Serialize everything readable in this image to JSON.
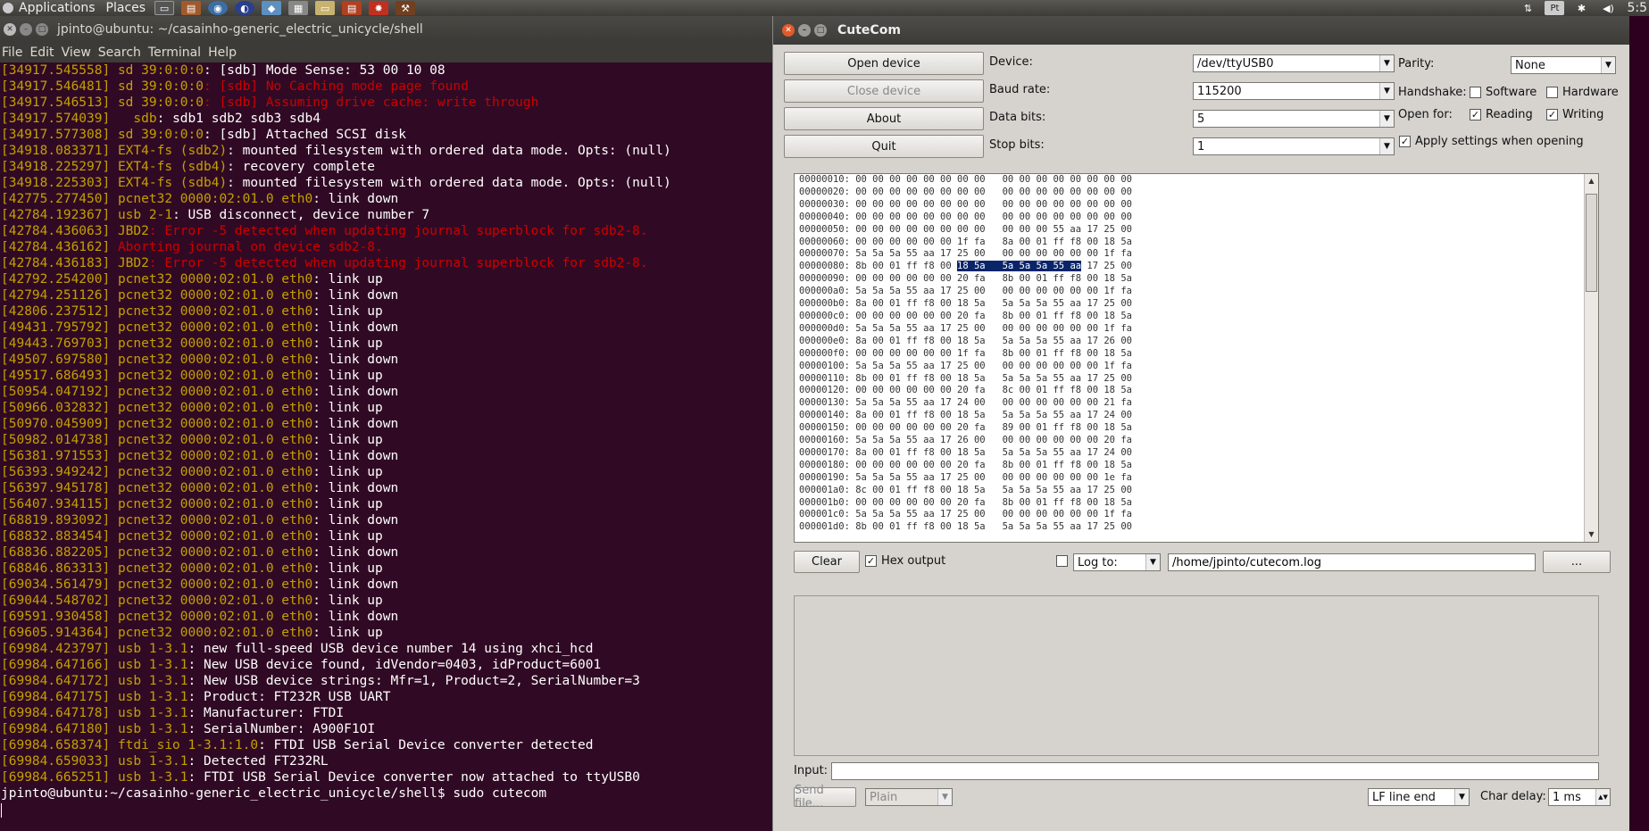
{
  "topbar": {
    "applications": "Applications",
    "places": "Places",
    "clock": "5:5"
  },
  "terminal": {
    "title": "jpinto@ubuntu: ~/casainho-generic_electric_unicycle/shell",
    "menu": [
      "File",
      "Edit",
      "View",
      "Search",
      "Terminal",
      "Help"
    ],
    "lines": [
      {
        "ts": "[34917.545558]",
        "src": "sd 39:0:0:0",
        "msg": ": [sdb] Mode Sense: 53 00 10 08",
        "err": false
      },
      {
        "ts": "[34917.546481]",
        "src": "sd 39:0:0:0",
        "msg": ": [sdb] No Caching mode page found",
        "err": true
      },
      {
        "ts": "[34917.546513]",
        "src": "sd 39:0:0:0",
        "msg": ": [sdb] Assuming drive cache: write through",
        "err": true
      },
      {
        "ts": "[34917.574039]",
        "src": "  sdb",
        "msg": ": sdb1 sdb2 sdb3 sdb4",
        "err": false
      },
      {
        "ts": "[34917.577308]",
        "src": "sd 39:0:0:0",
        "msg": ": [sdb] Attached SCSI disk",
        "err": false
      },
      {
        "ts": "[34918.083371]",
        "src": "EXT4-fs (sdb2)",
        "msg": ": mounted filesystem with ordered data mode. Opts: (null)",
        "err": false
      },
      {
        "ts": "[34918.225297]",
        "src": "EXT4-fs (sdb4)",
        "msg": ": recovery complete",
        "err": false
      },
      {
        "ts": "[34918.225303]",
        "src": "EXT4-fs (sdb4)",
        "msg": ": mounted filesystem with ordered data mode. Opts: (null)",
        "err": false
      },
      {
        "ts": "[42775.277450]",
        "src": "pcnet32 0000:02:01.0 eth0",
        "msg": ": link down",
        "err": false
      },
      {
        "ts": "[42784.192367]",
        "src": "usb 2-1",
        "msg": ": USB disconnect, device number 7",
        "err": false
      },
      {
        "ts": "[42784.436063]",
        "src": "JBD2",
        "msg": ": Error -5 detected when updating journal superblock for sdb2-8.",
        "err": true
      },
      {
        "ts": "[42784.436162]",
        "src": "",
        "msg": "Aborting journal on device sdb2-8.",
        "err": true
      },
      {
        "ts": "[42784.436183]",
        "src": "JBD2",
        "msg": ": Error -5 detected when updating journal superblock for sdb2-8.",
        "err": true
      },
      {
        "ts": "[42792.254200]",
        "src": "pcnet32 0000:02:01.0 eth0",
        "msg": ": link up",
        "err": false
      },
      {
        "ts": "[42794.251126]",
        "src": "pcnet32 0000:02:01.0 eth0",
        "msg": ": link down",
        "err": false
      },
      {
        "ts": "[42806.237512]",
        "src": "pcnet32 0000:02:01.0 eth0",
        "msg": ": link up",
        "err": false
      },
      {
        "ts": "[49431.795792]",
        "src": "pcnet32 0000:02:01.0 eth0",
        "msg": ": link down",
        "err": false
      },
      {
        "ts": "[49443.769703]",
        "src": "pcnet32 0000:02:01.0 eth0",
        "msg": ": link up",
        "err": false
      },
      {
        "ts": "[49507.697580]",
        "src": "pcnet32 0000:02:01.0 eth0",
        "msg": ": link down",
        "err": false
      },
      {
        "ts": "[49517.686493]",
        "src": "pcnet32 0000:02:01.0 eth0",
        "msg": ": link up",
        "err": false
      },
      {
        "ts": "[50954.047192]",
        "src": "pcnet32 0000:02:01.0 eth0",
        "msg": ": link down",
        "err": false
      },
      {
        "ts": "[50966.032832]",
        "src": "pcnet32 0000:02:01.0 eth0",
        "msg": ": link up",
        "err": false
      },
      {
        "ts": "[50970.045909]",
        "src": "pcnet32 0000:02:01.0 eth0",
        "msg": ": link down",
        "err": false
      },
      {
        "ts": "[50982.014738]",
        "src": "pcnet32 0000:02:01.0 eth0",
        "msg": ": link up",
        "err": false
      },
      {
        "ts": "[56381.971553]",
        "src": "pcnet32 0000:02:01.0 eth0",
        "msg": ": link down",
        "err": false
      },
      {
        "ts": "[56393.949242]",
        "src": "pcnet32 0000:02:01.0 eth0",
        "msg": ": link up",
        "err": false
      },
      {
        "ts": "[56397.945178]",
        "src": "pcnet32 0000:02:01.0 eth0",
        "msg": ": link down",
        "err": false
      },
      {
        "ts": "[56407.934115]",
        "src": "pcnet32 0000:02:01.0 eth0",
        "msg": ": link up",
        "err": false
      },
      {
        "ts": "[68819.893092]",
        "src": "pcnet32 0000:02:01.0 eth0",
        "msg": ": link down",
        "err": false
      },
      {
        "ts": "[68832.883454]",
        "src": "pcnet32 0000:02:01.0 eth0",
        "msg": ": link up",
        "err": false
      },
      {
        "ts": "[68836.882205]",
        "src": "pcnet32 0000:02:01.0 eth0",
        "msg": ": link down",
        "err": false
      },
      {
        "ts": "[68846.863313]",
        "src": "pcnet32 0000:02:01.0 eth0",
        "msg": ": link up",
        "err": false
      },
      {
        "ts": "[69034.561479]",
        "src": "pcnet32 0000:02:01.0 eth0",
        "msg": ": link down",
        "err": false
      },
      {
        "ts": "[69044.548702]",
        "src": "pcnet32 0000:02:01.0 eth0",
        "msg": ": link up",
        "err": false
      },
      {
        "ts": "[69591.930458]",
        "src": "pcnet32 0000:02:01.0 eth0",
        "msg": ": link down",
        "err": false
      },
      {
        "ts": "[69605.914364]",
        "src": "pcnet32 0000:02:01.0 eth0",
        "msg": ": link up",
        "err": false
      },
      {
        "ts": "[69984.423797]",
        "src": "usb 1-3.1",
        "msg": ": new full-speed USB device number 14 using xhci_hcd",
        "err": false
      },
      {
        "ts": "[69984.647166]",
        "src": "usb 1-3.1",
        "msg": ": New USB device found, idVendor=0403, idProduct=6001",
        "err": false
      },
      {
        "ts": "[69984.647172]",
        "src": "usb 1-3.1",
        "msg": ": New USB device strings: Mfr=1, Product=2, SerialNumber=3",
        "err": false
      },
      {
        "ts": "[69984.647175]",
        "src": "usb 1-3.1",
        "msg": ": Product: FT232R USB UART",
        "err": false
      },
      {
        "ts": "[69984.647178]",
        "src": "usb 1-3.1",
        "msg": ": Manufacturer: FTDI",
        "err": false
      },
      {
        "ts": "[69984.647180]",
        "src": "usb 1-3.1",
        "msg": ": SerialNumber: A900F1OI",
        "err": false
      },
      {
        "ts": "[69984.658374]",
        "src": "ftdi_sio 1-3.1:1.0",
        "msg": ": FTDI USB Serial Device converter detected",
        "err": false
      },
      {
        "ts": "[69984.659033]",
        "src": "usb 1-3.1",
        "msg": ": Detected FT232RL",
        "err": false
      },
      {
        "ts": "[69984.665251]",
        "src": "usb 1-3.1",
        "msg": ": FTDI USB Serial Device converter now attached to ttyUSB0",
        "err": false
      }
    ],
    "prompt": "jpinto@ubuntu:~/casainho-generic_electric_unicycle/shell$ sudo cutecom"
  },
  "cutecom": {
    "title": "CuteCom",
    "buttons": {
      "open": "Open device",
      "close": "Close device",
      "about": "About",
      "quit": "Quit"
    },
    "labels": {
      "device": "Device:",
      "baud": "Baud rate:",
      "databits": "Data bits:",
      "stopbits": "Stop bits:",
      "parity": "Parity:",
      "handshake": "Handshake:",
      "software": "Software",
      "hardware": "Hardware",
      "openfor": "Open for:",
      "reading": "Reading",
      "writing": "Writing",
      "apply": "Apply settings when opening"
    },
    "values": {
      "device": "/dev/ttyUSB0",
      "baud": "115200",
      "databits": "5",
      "stopbits": "1",
      "parity": "None"
    },
    "hex_lines": [
      "00000010: 00 00 00 00 00 00 00 00   00 00 00 00 00 00 00 00",
      "00000020: 00 00 00 00 00 00 00 00   00 00 00 00 00 00 00 00",
      "00000030: 00 00 00 00 00 00 00 00   00 00 00 00 00 00 00 00",
      "00000040: 00 00 00 00 00 00 00 00   00 00 00 00 00 00 00 00",
      "00000050: 00 00 00 00 00 00 00 00   00 00 00 55 aa 17 25 00",
      "00000060: 00 00 00 00 00 00 1f fa   8a 00 01 ff f8 00 18 5a",
      "00000070: 5a 5a 5a 55 aa 17 25 00   00 00 00 00 00 00 1f fa",
      "00000090: 00 00 00 00 00 00 20 fa   8b 00 01 ff f8 00 18 5a",
      "000000a0: 5a 5a 5a 55 aa 17 25 00   00 00 00 00 00 00 1f fa",
      "000000b0: 8a 00 01 ff f8 00 18 5a   5a 5a 5a 55 aa 17 25 00",
      "000000c0: 00 00 00 00 00 00 20 fa   8b 00 01 ff f8 00 18 5a",
      "000000d0: 5a 5a 5a 55 aa 17 25 00   00 00 00 00 00 00 1f fa",
      "000000e0: 8a 00 01 ff f8 00 18 5a   5a 5a 5a 55 aa 17 26 00",
      "000000f0: 00 00 00 00 00 00 1f fa   8b 00 01 ff f8 00 18 5a",
      "00000100: 5a 5a 5a 55 aa 17 25 00   00 00 00 00 00 00 1f fa",
      "00000110: 8b 00 01 ff f8 00 18 5a   5a 5a 5a 55 aa 17 25 00",
      "00000120: 00 00 00 00 00 00 20 fa   8c 00 01 ff f8 00 18 5a",
      "00000130: 5a 5a 5a 55 aa 17 24 00   00 00 00 00 00 00 21 fa",
      "00000140: 8a 00 01 ff f8 00 18 5a   5a 5a 5a 55 aa 17 24 00",
      "00000150: 00 00 00 00 00 00 20 fa   89 00 01 ff f8 00 18 5a",
      "00000160: 5a 5a 5a 55 aa 17 26 00   00 00 00 00 00 00 20 fa",
      "00000170: 8a 00 01 ff f8 00 18 5a   5a 5a 5a 55 aa 17 24 00",
      "00000180: 00 00 00 00 00 00 20 fa   8b 00 01 ff f8 00 18 5a",
      "00000190: 5a 5a 5a 55 aa 17 25 00   00 00 00 00 00 00 1e fa",
      "000001a0: 8c 00 01 ff f8 00 18 5a   5a 5a 5a 55 aa 17 25 00",
      "000001b0: 00 00 00 00 00 00 20 fa   8b 00 01 ff f8 00 18 5a",
      "000001c0: 5a 5a 5a 55 aa 17 25 00   00 00 00 00 00 00 1f fa",
      "000001d0: 8b 00 01 ff f8 00 18 5a   5a 5a 5a 55 aa 17 25 00"
    ],
    "hex_highlight_line": {
      "pre": "00000080: 8b 00 01 ff f8 00 ",
      "hl": "18 5a   5a 5a 5a 55 aa",
      "post": " 17 25 00"
    },
    "controls": {
      "clear": "Clear",
      "hex_output": "Hex output",
      "log_to": "Log to:",
      "log_path": "/home/jpinto/cutecom.log",
      "browse": "...",
      "input": "Input:",
      "send_file": "Send file...",
      "plain": "Plain",
      "line_end": "LF line end",
      "char_delay_label": "Char delay:",
      "char_delay": "1 ms"
    }
  }
}
